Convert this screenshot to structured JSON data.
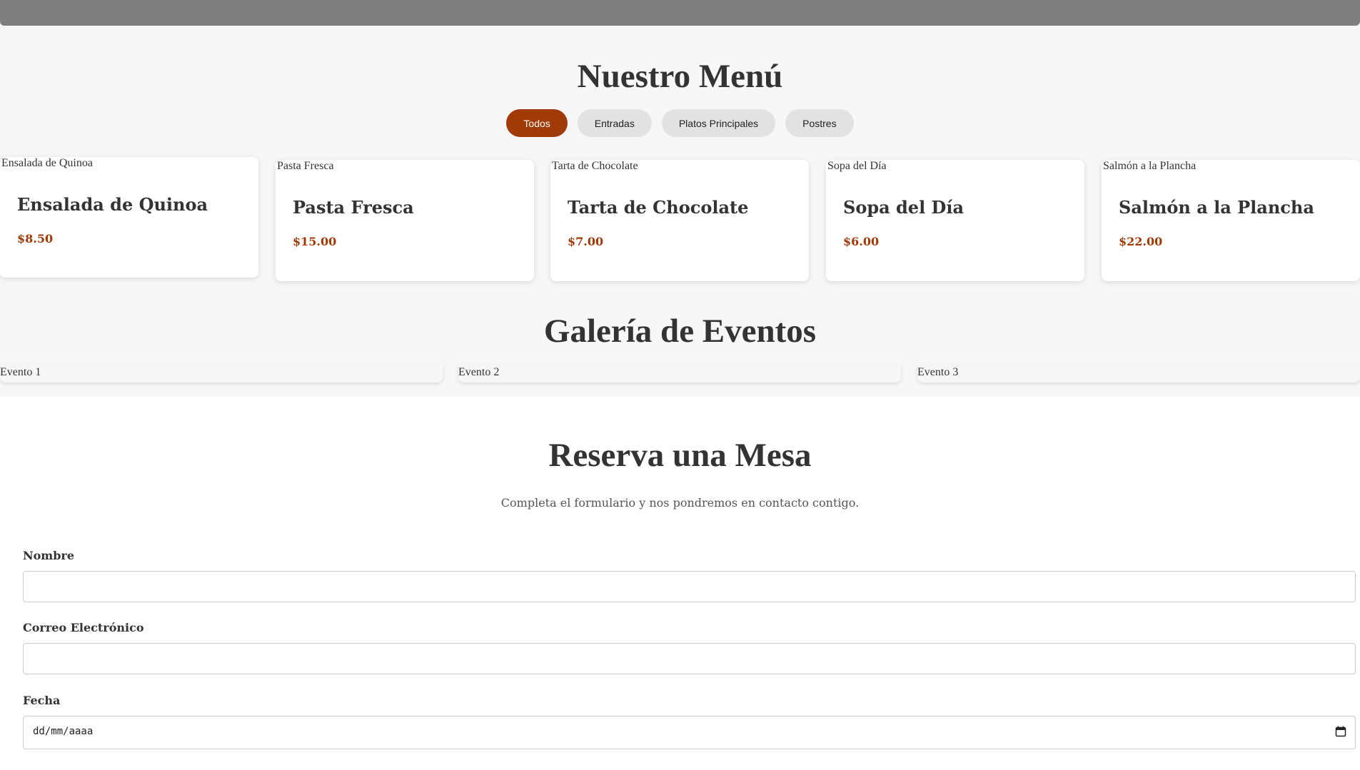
{
  "menu": {
    "title": "Nuestro Menú",
    "filters": [
      {
        "label": "Todos",
        "active": true
      },
      {
        "label": "Entradas",
        "active": false
      },
      {
        "label": "Platos Principales",
        "active": false
      },
      {
        "label": "Postres",
        "active": false
      }
    ],
    "items": [
      {
        "alt": "Ensalada de Quinoa",
        "name": "Ensalada de Quinoa",
        "price": "$8.50"
      },
      {
        "alt": "Pasta Fresca",
        "name": "Pasta Fresca",
        "price": "$15.00"
      },
      {
        "alt": "Tarta de Chocolate",
        "name": "Tarta de Chocolate",
        "price": "$7.00"
      },
      {
        "alt": "Sopa del Día",
        "name": "Sopa del Día",
        "price": "$6.00"
      },
      {
        "alt": "Salmón a la Plancha",
        "name": "Salmón a la Plancha",
        "price": "$22.00"
      }
    ]
  },
  "gallery": {
    "title": "Galería de Eventos",
    "events": [
      {
        "alt": "Evento 1"
      },
      {
        "alt": "Evento 2"
      },
      {
        "alt": "Evento 3"
      }
    ]
  },
  "reservation": {
    "title": "Reserva una Mesa",
    "subtitle": "Completa el formulario y nos pondremos en contacto contigo.",
    "fields": {
      "name_label": "Nombre",
      "email_label": "Correo Electrónico",
      "date_label": "Fecha",
      "date_placeholder": "dd/mm/aaaa"
    }
  },
  "colors": {
    "accent": "#a03a07",
    "topbar": "#7f7f7f",
    "section_bg": "#f7f7f7"
  },
  "icons": {
    "date": "calendar-icon"
  }
}
